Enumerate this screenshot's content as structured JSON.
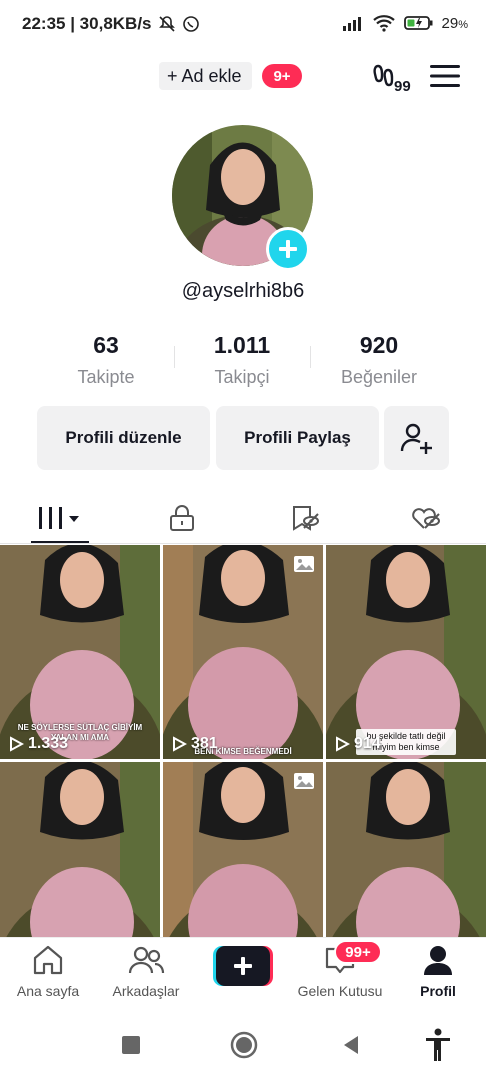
{
  "status": {
    "time_speed": "22:35 | 30,8KB/s",
    "battery": "29",
    "battery_unit": "%"
  },
  "topbar": {
    "ad_label": "+ Ad ekle",
    "ad_badge": "9+",
    "footprint_count": "99"
  },
  "profile": {
    "username": "@ayselrhi8b6"
  },
  "stats": [
    {
      "value": "63",
      "label": "Takipte"
    },
    {
      "value": "1.011",
      "label": "Takipçi"
    },
    {
      "value": "920",
      "label": "Beğeniler"
    }
  ],
  "actions": {
    "edit_profile": "Profili düzenle",
    "share_profile": "Profili Paylaş"
  },
  "videos": [
    {
      "views": "1.333",
      "caption": "NE SÖYLERSE SÜTLAÇ GİBİYİM YALAN MI AMA"
    },
    {
      "views": "381",
      "caption": "BENİ KİMSE BEĞENMEDİ"
    },
    {
      "views": "914",
      "caption": "bu şekilde tatlı değil miyim ben kimse"
    },
    {
      "views": "",
      "caption": ""
    },
    {
      "views": "",
      "caption": ""
    },
    {
      "views": "",
      "caption": ""
    }
  ],
  "bottomnav": {
    "home": "Ana sayfa",
    "friends": "Arkadaşlar",
    "inbox": "Gelen Kutusu",
    "inbox_badge": "99+",
    "profile": "Profil"
  },
  "colors": {
    "accent": "#fe2c55",
    "cyan": "#20d5ec"
  }
}
